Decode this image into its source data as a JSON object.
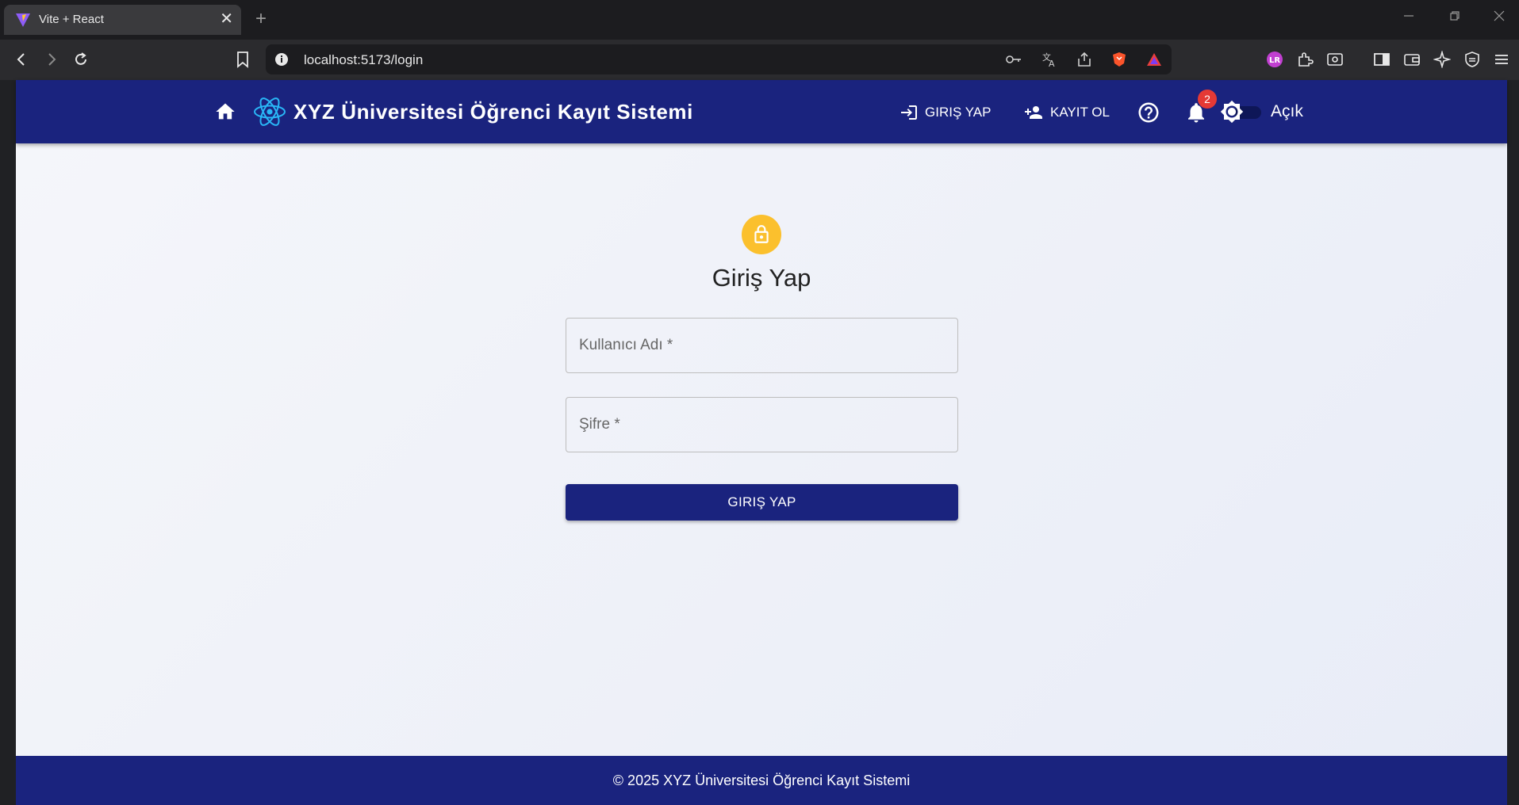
{
  "browser": {
    "tab_title": "Vite + React",
    "tab_close": "✕",
    "new_tab": "+",
    "url": "localhost:5173/login"
  },
  "appbar": {
    "title": "XYZ Üniversitesi Öğrenci Kayıt Sistemi",
    "login_label": "GIRIŞ YAP",
    "register_label": "KAYIT OL",
    "notification_count": "2",
    "theme_label": "Açık"
  },
  "login": {
    "title": "Giriş Yap",
    "username_placeholder": "Kullanıcı Adı *",
    "password_placeholder": "Şifre *",
    "submit_label": "GIRIŞ YAP"
  },
  "footer": {
    "text": "© 2025 XYZ Üniversitesi Öğrenci Kayıt Sistemi"
  },
  "colors": {
    "primary": "#1a237e",
    "accent": "#fbc02d",
    "badge": "#e53935"
  }
}
